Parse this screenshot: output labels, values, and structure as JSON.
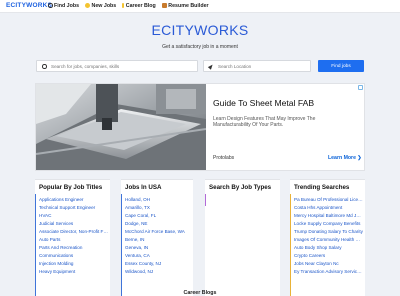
{
  "nav": {
    "logo": "ECITYWORKS",
    "links": [
      {
        "label": "Find Jobs",
        "icon": "search-icon"
      },
      {
        "label": "New Jobs",
        "icon": "new-badge-icon"
      },
      {
        "label": "Career Blog",
        "icon": "pencil-icon"
      },
      {
        "label": "Resume Builder",
        "icon": "briefcase-icon"
      }
    ]
  },
  "hero": {
    "title": "ECITYWORKS",
    "subtitle": "Get a satisfactory job in a moment"
  },
  "search": {
    "jobs_placeholder": "Search for jobs, companies, skills",
    "location_placeholder": "Search Location",
    "button_label": "Find jobs"
  },
  "ad": {
    "title": "Guide To Sheet Metal FAB",
    "description": "Learn Design Features That May Improve The Manufacturability Of Your Parts.",
    "brand": "Protolabs",
    "cta": "Learn More ❯"
  },
  "columns": [
    {
      "title": "Popular By Job Titles",
      "accent": "#3f74d9",
      "items": [
        "Applications Engineer",
        "Technical Support Engineer",
        "HVAC",
        "Judicial Services",
        "Associate Director, Non-Profit Fund...",
        "Auto Parts",
        "Parts And Recreation",
        "Communications",
        "Injection Molding",
        "Heavy Equipment"
      ]
    },
    {
      "title": "Jobs In USA",
      "accent": "#3f74d9",
      "items": [
        "Holland, OH",
        "Amarillo, TX",
        "Cape Coral, FL",
        "Dodge, NE",
        "McChord Air Force Base, WA",
        "Berne, IN",
        "Geneva, IN",
        "Ventura, CA",
        "Essex County, NJ",
        "Wildwood, NJ"
      ]
    },
    {
      "title": "Search By Job Types",
      "accent": "#b26ad8",
      "items": []
    },
    {
      "title": "Trending Searches",
      "accent": "#e9b237",
      "items": [
        "Pa Bureau Of Professional Licensing",
        "Costa Hhs Appointment",
        "Mercy Hospital Baltimore Md Jobs",
        "Locke Supply Company Benefits",
        "Trump Donating Salary To Charity",
        "Images Of Community Health Clinic",
        "Auto Body Shop Salary",
        "Crypto Careers",
        "Jobs Near Clayton Nc",
        "Ey Transaction Advisory Services Salary"
      ]
    }
  ],
  "footer": {
    "next_section": "Career Blogs"
  }
}
